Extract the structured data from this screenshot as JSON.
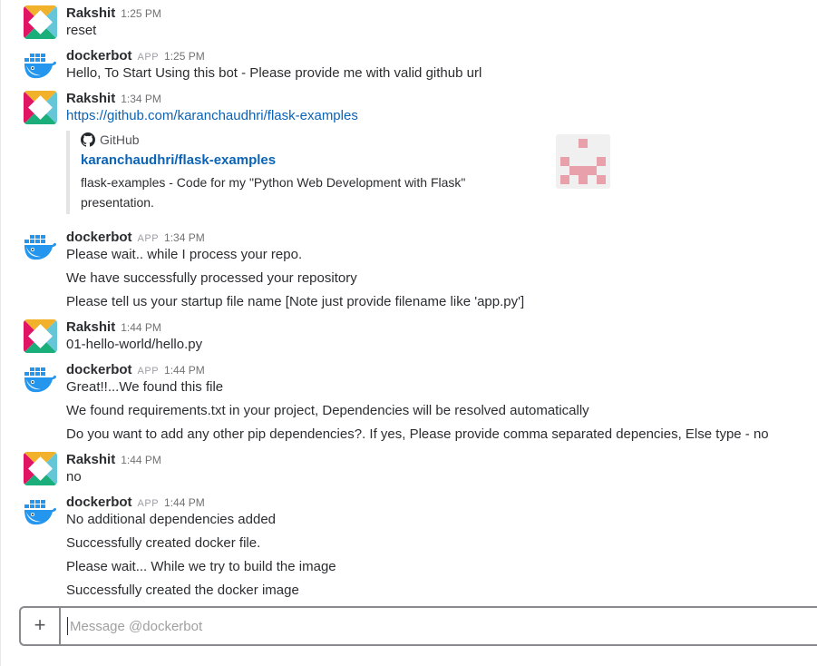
{
  "messages": [
    {
      "sender": "Rakshit",
      "avatar_icon": "slack-logo-avatar",
      "time": "1:25 PM",
      "lines": [
        "reset"
      ]
    },
    {
      "sender": "dockerbot",
      "avatar_icon": "docker-whale-avatar",
      "badge": "APP",
      "time": "1:25 PM",
      "lines": [
        "Hello, To Start Using this bot - Please provide me with valid github url"
      ]
    },
    {
      "sender": "Rakshit",
      "avatar_icon": "slack-logo-avatar",
      "time": "1:34 PM",
      "link": "https://github.com/karanchaudhri/flask-examples",
      "attachment": {
        "service_icon": "github-icon",
        "service": "GitHub",
        "title": "karanchaudhri/flask-examples",
        "text": "flask-examples - Code for my \"Python Web Development with Flask\" presentation.",
        "thumb_icon": "identicon-thumbnail"
      }
    },
    {
      "sender": "dockerbot",
      "avatar_icon": "docker-whale-avatar",
      "badge": "APP",
      "time": "1:34 PM",
      "lines": [
        "Please wait.. while I process your repo.",
        "We have successfully processed your repository",
        "Please tell us your startup file name [Note just provide filename like 'app.py']"
      ]
    },
    {
      "sender": "Rakshit",
      "avatar_icon": "slack-logo-avatar",
      "time": "1:44 PM",
      "lines": [
        "01-hello-world/hello.py"
      ]
    },
    {
      "sender": "dockerbot",
      "avatar_icon": "docker-whale-avatar",
      "badge": "APP",
      "time": "1:44 PM",
      "lines": [
        "Great!!...We found this file",
        "We found requirements.txt in your project, Dependencies will be resolved automatically",
        "Do you want to add any other pip dependencies?. If yes, Please provide comma separated depencies, Else type - no"
      ]
    },
    {
      "sender": "Rakshit",
      "avatar_icon": "slack-logo-avatar",
      "time": "1:44 PM",
      "lines": [
        "no"
      ]
    },
    {
      "sender": "dockerbot",
      "avatar_icon": "docker-whale-avatar",
      "badge": "APP",
      "time": "1:44 PM",
      "lines": [
        "No additional dependencies added",
        "Successfully created docker file.",
        "Please wait... While we try to build the image",
        "Successfully created the docker image"
      ]
    }
  ],
  "composer": {
    "plus_icon": "plus-icon",
    "plus_label": "+",
    "placeholder": "Message @dockerbot",
    "value": ""
  },
  "colors": {
    "link": "#0b63b6",
    "text": "#2c2d30",
    "muted": "#717274"
  }
}
